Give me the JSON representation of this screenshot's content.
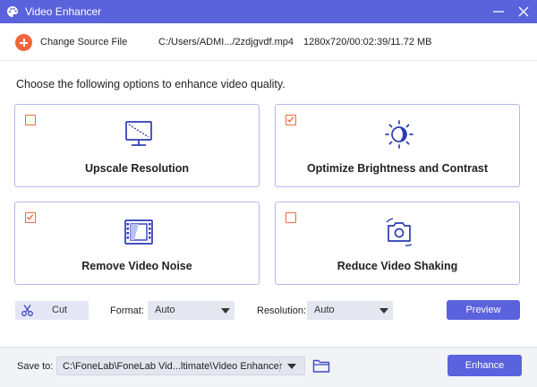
{
  "window": {
    "title": "Video Enhancer",
    "icons": {
      "app": "palette-icon",
      "minimize": "minimize-icon",
      "close": "close-icon"
    }
  },
  "source": {
    "change_label": "Change Source File",
    "file_path": "C:/Users/ADMI.../2zdjgvdf.mp4",
    "file_info": "1280x720/00:02:39/11.72 MB",
    "add_icon": "plus-circle-icon"
  },
  "instruction": "Choose the following options to enhance video quality.",
  "options": [
    {
      "label": "Upscale Resolution",
      "checked": false,
      "icon": "upscale-resolution-icon"
    },
    {
      "label": "Optimize Brightness and Contrast",
      "checked": true,
      "icon": "brightness-icon"
    },
    {
      "label": "Remove Video Noise",
      "checked": true,
      "icon": "film-strip-icon"
    },
    {
      "label": "Reduce Video Shaking",
      "checked": false,
      "icon": "camera-rotate-icon"
    }
  ],
  "controls": {
    "cut_label": "Cut",
    "format_label": "Format:",
    "format_value": "Auto",
    "resolution_label": "Resolution:",
    "resolution_value": "Auto",
    "preview_label": "Preview"
  },
  "footer": {
    "save_label": "Save to:",
    "save_path": "C:\\FoneLab\\FoneLab Vid...ltimate\\Video Enhancer",
    "enhance_label": "Enhance"
  },
  "colors": {
    "accent": "#5b62dd",
    "orange": "#f2643a",
    "card_border": "#b5b8ea"
  }
}
